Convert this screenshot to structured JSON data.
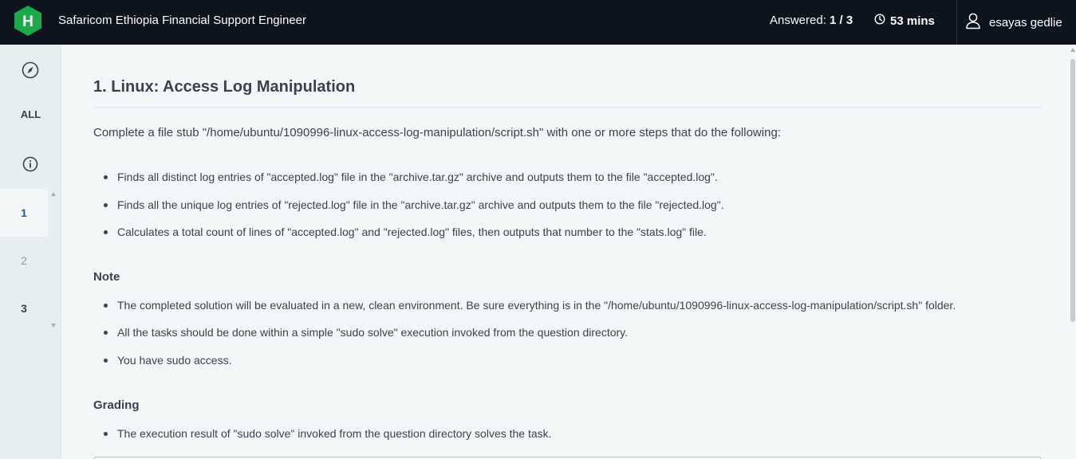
{
  "header": {
    "logo_letter": "H",
    "test_title": "Safaricom Ethiopia Financial Support Engineer",
    "answered_label": "Answered:",
    "answered_value": "1 / 3",
    "timer": "53 mins",
    "user_name": "esayas gedlie",
    "brand_color": "#1ba94c"
  },
  "sidebar": {
    "all_label": "ALL",
    "questions": [
      "1",
      "2",
      "3"
    ]
  },
  "question": {
    "title": "1. Linux: Access Log Manipulation",
    "intro": "Complete a file stub \"/home/ubuntu/1090996-linux-access-log-manipulation/script.sh\" with one or more steps that do the following:",
    "steps": [
      "Finds all distinct log entries of \"accepted.log\" file in the \"archive.tar.gz\" archive and outputs them to the file \"accepted.log\".",
      "Finds all the unique log entries of \"rejected.log\" file in the \"archive.tar.gz\" archive and outputs them to the file \"rejected.log\".",
      "Calculates a total count of lines of \"accepted.log\" and \"rejected.log\" files, then outputs that number to the \"stats.log\" file."
    ],
    "note_heading": "Note",
    "notes": [
      "The completed solution will be evaluated in a new, clean environment. Be sure everything is in the \"/home/ubuntu/1090996-linux-access-log-manipulation/script.sh\" folder.",
      "All the tasks should be done within a simple \"sudo solve\" execution invoked from the question directory.",
      "You have sudo access."
    ],
    "grading_heading": "Grading",
    "grading": [
      "The execution result of \"sudo solve\" invoked from the question directory solves the task."
    ]
  }
}
